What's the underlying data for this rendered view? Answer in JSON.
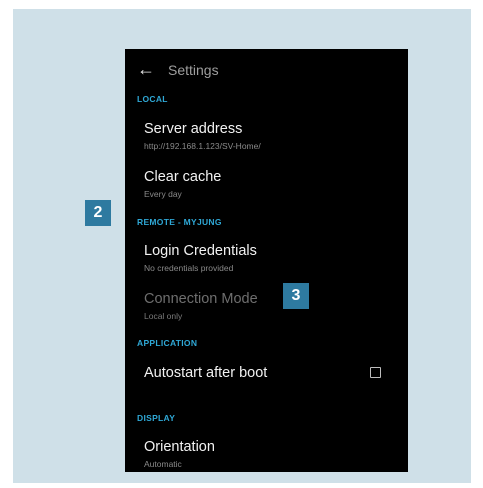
{
  "appbar": {
    "back_icon": "arrow-back-icon",
    "title": "Settings"
  },
  "sections": {
    "local": "LOCAL",
    "remote": "REMOTE - MYJUNG",
    "application": "APPLICATION",
    "display": "DISPLAY"
  },
  "items": {
    "server_address": {
      "title": "Server address",
      "summary": "http://192.168.1.123/SV-Home/"
    },
    "clear_cache": {
      "title": "Clear cache",
      "summary": "Every day"
    },
    "login_credentials": {
      "title": "Login Credentials",
      "summary": "No credentials provided"
    },
    "connection_mode": {
      "title": "Connection Mode",
      "summary": "Local only",
      "enabled": false
    },
    "autostart": {
      "title": "Autostart after boot",
      "checked": false
    },
    "orientation": {
      "title": "Orientation",
      "summary": "Automatic"
    }
  },
  "callouts": {
    "badge_2": "2",
    "badge_3": "3"
  },
  "colors": {
    "frame_background": "#cfe0e8",
    "screen_background": "#000000",
    "section_header": "#2fa8d6",
    "callout_badge": "#2e7aa0"
  }
}
